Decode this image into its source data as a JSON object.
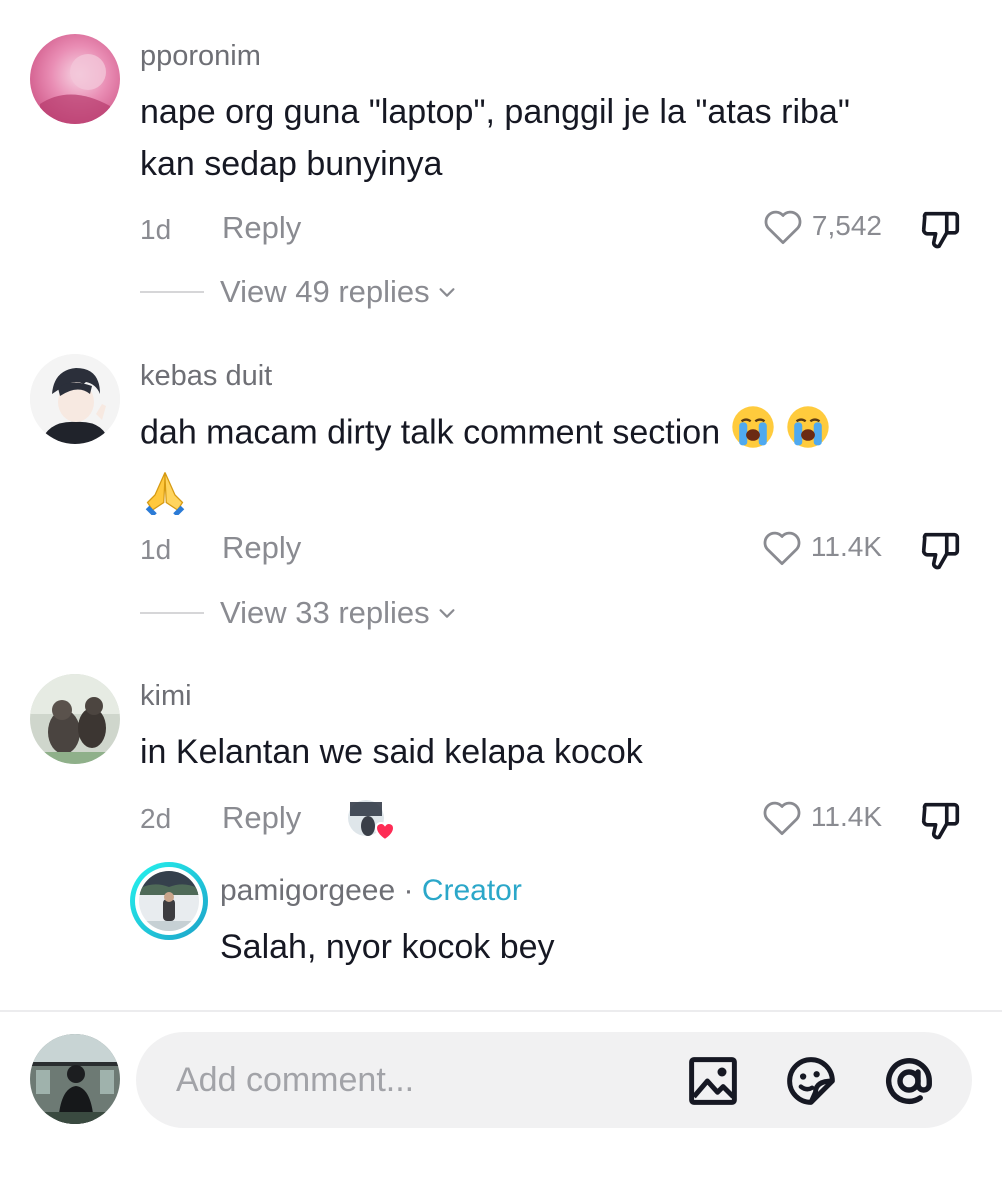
{
  "comments": [
    {
      "username": "pporonim",
      "text": "nape org guna \"laptop\", panggil je la \"atas riba\" kan sedap bunyinya",
      "time": "1d",
      "reply_label": "Reply",
      "likes": "7,542",
      "view_replies": "View 49 replies"
    },
    {
      "username": "kebas duit",
      "text": "dah macam dirty talk comment section",
      "time": "1d",
      "reply_label": "Reply",
      "likes": "11.4K",
      "view_replies": "View 33 replies"
    },
    {
      "username": "kimi",
      "text": "in Kelantan we said kelapa kocok",
      "time": "2d",
      "reply_label": "Reply",
      "likes": "11.4K",
      "creator_reply": {
        "username": "pamigorgeee",
        "separator": "·",
        "badge": "Creator",
        "text": "Salah, nyor kocok bey"
      }
    }
  ],
  "composer": {
    "placeholder": "Add comment..."
  },
  "icons": {
    "like": "heart-outline-icon",
    "dislike": "thumbs-down-icon",
    "chevron": "chevron-down-icon",
    "image": "image-icon",
    "emoji": "emoji-sticker-icon",
    "mention": "at-mention-icon"
  }
}
